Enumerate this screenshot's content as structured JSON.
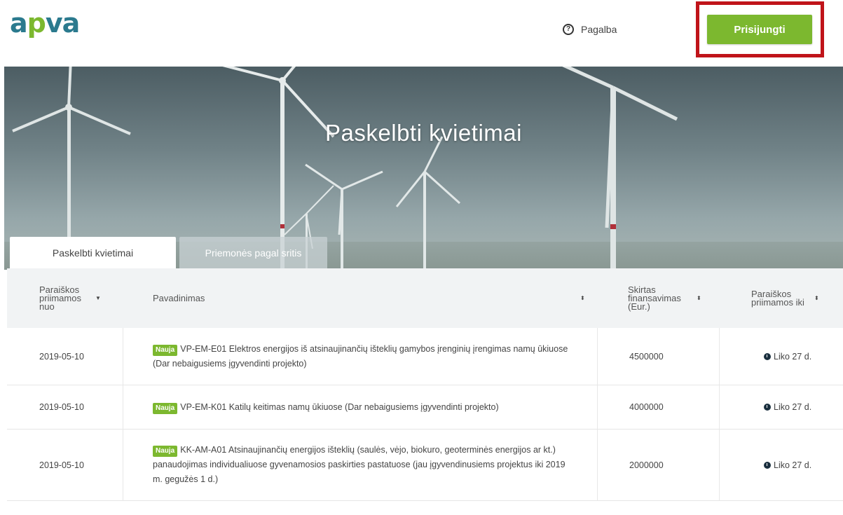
{
  "header": {
    "logo_part1": "a",
    "logo_part2": "p",
    "logo_part3": "va",
    "help_icon": "?",
    "help_label": "Pagalba",
    "login_label": "Prisijungti",
    "highlight_color": "#c0141a",
    "accent_color": "#7cb82f"
  },
  "hero": {
    "title": "Paskelbti kvietimai"
  },
  "tabs": [
    {
      "label": "Paskelbti kvietimai",
      "active": true
    },
    {
      "label": "Priemonės pagal sritis",
      "active": false
    }
  ],
  "table": {
    "columns": [
      {
        "label": "Paraiškos priimamos nuo",
        "sort_icon": "caret-down-icon",
        "sort_glyph": "▼"
      },
      {
        "label": "Pavadinimas",
        "sort_icon": "sort-both-icon",
        "sort_glyph": "⬍"
      },
      {
        "label": "Skirtas finansavimas (Eur.)",
        "sort_icon": "sort-both-icon",
        "sort_glyph": "⬍"
      },
      {
        "label": "Paraiškos priimamos iki",
        "sort_icon": "sort-both-icon",
        "sort_glyph": "⬍"
      }
    ],
    "rows": [
      {
        "date": "2019-05-10",
        "badge": "Nauja",
        "title": "VP-EM-E01 Elektros energijos iš atsinaujinančių išteklių gamybos įrenginių įrengimas namų ūkiuose (Dar nebaigusiems įgyvendinti projekto)",
        "funding": "4500000",
        "deadline": "Liko 27 d."
      },
      {
        "date": "2019-05-10",
        "badge": "Nauja",
        "title": "VP-EM-K01 Katilų keitimas namų ūkiuose (Dar nebaigusiems įgyvendinti projekto)",
        "funding": "4000000",
        "deadline": "Liko 27 d."
      },
      {
        "date": "2019-05-10",
        "badge": "Nauja",
        "title": "KK-AM-A01 Atsinaujinančių energijos išteklių (saulės, vėjo, biokuro, geoterminės energijos ar kt.) panaudojimas individualiuose gyvenamosios paskirties pastatuose (jau įgyvendinusiems projektus iki 2019 m. gegužės 1 d.)",
        "funding": "2000000",
        "deadline": "Liko 27 d."
      }
    ]
  }
}
